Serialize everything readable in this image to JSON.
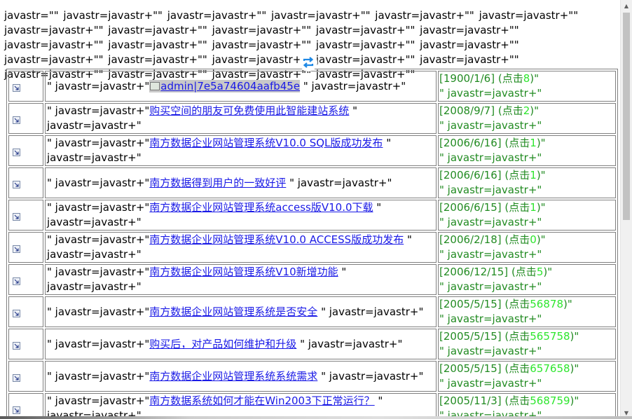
{
  "header": {
    "text": "javastr=\"\" javastr=javastr+\"\" javastr=javastr+\"\" javastr=javastr+\"\" javastr=javastr+\"\" javastr=javastr+\"\" javastr=javastr+\"\" javastr=javastr+\"\" javastr=javastr+\"\" javastr=javastr+\"\" javastr=javastr+\"\" javastr=javastr+\"\" javastr=javastr+\"\" javastr=javastr+\"\" javastr=javastr+\"\" javastr=javastr+\"\" javastr=javastr+\"\" javastr=javastr+\"\" javastr=javastr+\"\" javastr=javastr+\"\" javastr=javastr+\"\" javastr=javastr+\"\" javastr=javastr+\"\" javastr=javastr+\"\" javastr=javastr+\"\""
  },
  "prefix": "\" javastr=javastr+\"",
  "suffix": " \" javastr=javastr+\"",
  "hits_label": "(点击",
  "close_paren": ")\"",
  "rows": [
    {
      "title": "admin|7e5a74604aafb45e",
      "date": "[1900/1/6]",
      "hits": "8",
      "highlight": true
    },
    {
      "title": "购买空间的朋友可免费使用此智能建站系统",
      "date": "[2008/9/7]",
      "hits": "2"
    },
    {
      "title": "南方数据企业网站管理系统V10.0 SQL版成功发布",
      "date": "[2006/6/16]",
      "hits": "1"
    },
    {
      "title": "南方数据得到用户的一致好评",
      "date": "[2006/6/16]",
      "hits": "1"
    },
    {
      "title": "南方数据企业网站管理系统access版V10.0下载",
      "date": "[2006/6/15]",
      "hits": "1"
    },
    {
      "title": "南方数据企业网站管理系统V10.0 ACCESS版成功发布",
      "date": "[2006/2/18]",
      "hits": "0"
    },
    {
      "title": "南方数据企业网站管理系统V10新增功能",
      "date": "[2006/12/15]",
      "hits": "5"
    },
    {
      "title": "南方数据企业网站管理系统是否安全",
      "date": "[2005/5/15]",
      "hits": "56878"
    },
    {
      "title": "购买后，对产品如何维护和升级",
      "date": "[2005/5/15]",
      "hits": "565758"
    },
    {
      "title": "南方数据企业网站管理系统系统需求",
      "date": "[2005/5/15]",
      "hits": "657658"
    },
    {
      "title": "南方数据系统如何才能在Win2003下正常运行？",
      "date": "[2005/11/3]",
      "hits": "568759"
    }
  ],
  "icons": {
    "sync": "sync-icon",
    "row": "arrow-down-right-icon"
  }
}
